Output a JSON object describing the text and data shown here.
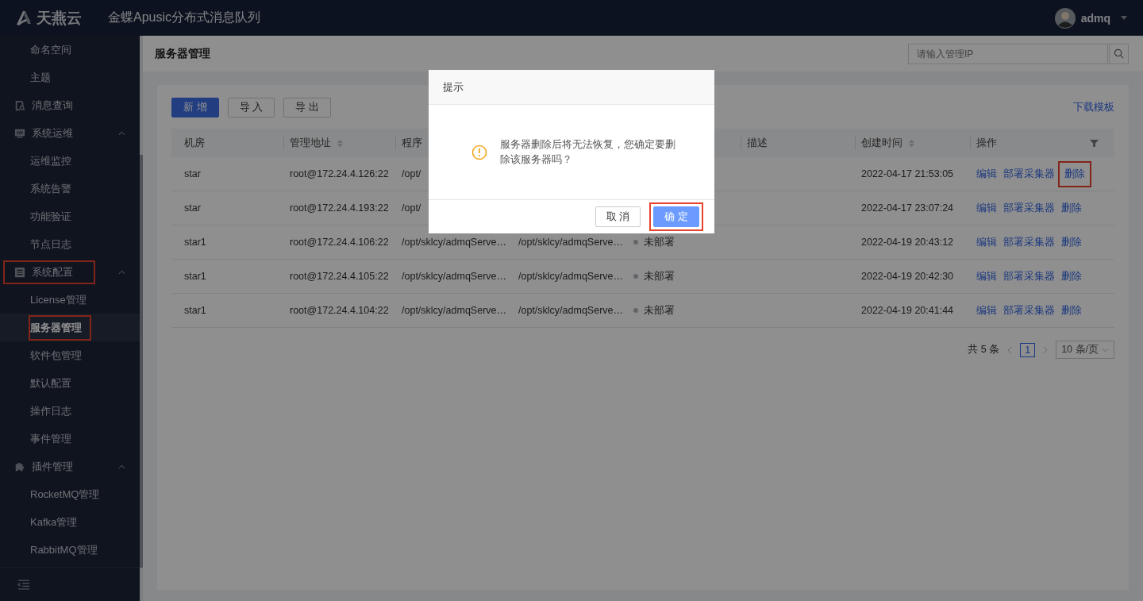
{
  "header": {
    "logo_text": "天燕云",
    "app_title": "金蝶Apusic分布式消息队列",
    "user": "admq"
  },
  "sidebar": {
    "items": [
      {
        "kind": "item",
        "label": "命名空间",
        "selected": false,
        "highlighted": false
      },
      {
        "kind": "item",
        "label": "主题",
        "selected": false,
        "highlighted": false
      },
      {
        "kind": "link",
        "label": "消息查询",
        "selected": false,
        "highlighted": false
      },
      {
        "kind": "group",
        "label": "系统运维",
        "expanded": true,
        "highlighted": false,
        "children": [
          {
            "label": "运维监控",
            "selected": false,
            "highlighted": false
          },
          {
            "label": "系统告警",
            "selected": false,
            "highlighted": false
          },
          {
            "label": "功能验证",
            "selected": false,
            "highlighted": false
          },
          {
            "label": "节点日志",
            "selected": false,
            "highlighted": false
          }
        ]
      },
      {
        "kind": "group",
        "label": "系统配置",
        "expanded": true,
        "highlighted": true,
        "children": [
          {
            "label": "License管理",
            "selected": false,
            "highlighted": false
          },
          {
            "label": "服务器管理",
            "selected": true,
            "highlighted": true
          },
          {
            "label": "软件包管理",
            "selected": false,
            "highlighted": false
          },
          {
            "label": "默认配置",
            "selected": false,
            "highlighted": false
          },
          {
            "label": "操作日志",
            "selected": false,
            "highlighted": false
          },
          {
            "label": "事件管理",
            "selected": false,
            "highlighted": false
          }
        ]
      },
      {
        "kind": "group",
        "label": "插件管理",
        "expanded": true,
        "highlighted": false,
        "children": [
          {
            "label": "RocketMQ管理",
            "selected": false,
            "highlighted": false
          },
          {
            "label": "Kafka管理",
            "selected": false,
            "highlighted": false
          },
          {
            "label": "RabbitMQ管理",
            "selected": false,
            "highlighted": false
          }
        ]
      }
    ]
  },
  "page": {
    "title": "服务器管理",
    "search": {
      "placeholder": "请输入管理IP"
    }
  },
  "toolbar": {
    "buttons": [
      {
        "label": "新 增",
        "kind": "primary"
      },
      {
        "label": "导 入",
        "kind": "default"
      },
      {
        "label": "导 出",
        "kind": "default"
      }
    ],
    "link": "下载模板"
  },
  "table": {
    "columns": [
      {
        "label": "机房",
        "sortable": false
      },
      {
        "label": "管理地址",
        "sortable": true
      },
      {
        "label": "程序"
      },
      {},
      {},
      {
        "label": "描述",
        "sortable": false
      },
      {
        "label": "创建时间",
        "sortable": true
      },
      {
        "label": "操作",
        "sortable": false,
        "filter": true
      }
    ],
    "rows": [
      {
        "cells": [
          "star",
          "root@172.24.4.126:22",
          "/opt/",
          null,
          null,
          null,
          "2022-04-17 21:53:05"
        ],
        "actions": [
          {
            "label": "编辑",
            "highlighted": false
          },
          {
            "label": "部署采集器",
            "highlighted": false
          },
          {
            "label": "删除",
            "highlighted": true
          }
        ]
      },
      {
        "cells": [
          "star",
          "root@172.24.4.193:22",
          "/opt/",
          null,
          null,
          null,
          "2022-04-17 23:07:24"
        ],
        "actions": [
          {
            "label": "编辑",
            "highlighted": false
          },
          {
            "label": "部署采集器",
            "highlighted": false
          },
          {
            "label": "删除",
            "highlighted": false
          }
        ]
      },
      {
        "cells": [
          "star1",
          "root@172.24.4.106:22",
          "/opt/sklcy/admqServe…",
          "/opt/sklcy/admqServe…",
          "未部署",
          null,
          "2022-04-19 20:43:12"
        ],
        "actions": [
          {
            "label": "编辑",
            "highlighted": false
          },
          {
            "label": "部署采集器",
            "highlighted": false
          },
          {
            "label": "删除",
            "highlighted": false
          }
        ]
      },
      {
        "cells": [
          "star1",
          "root@172.24.4.105:22",
          "/opt/sklcy/admqServe…",
          "/opt/sklcy/admqServe…",
          "未部署",
          null,
          "2022-04-19 20:42:30"
        ],
        "actions": [
          {
            "label": "编辑",
            "highlighted": false
          },
          {
            "label": "部署采集器",
            "highlighted": false
          },
          {
            "label": "删除",
            "highlighted": false
          }
        ]
      },
      {
        "cells": [
          "star1",
          "root@172.24.4.104:22",
          "/opt/sklcy/admqServe…",
          "/opt/sklcy/admqServe…",
          "未部署",
          null,
          "2022-04-19 20:41:44"
        ],
        "actions": [
          {
            "label": "编辑",
            "highlighted": false
          },
          {
            "label": "部署采集器",
            "highlighted": false
          },
          {
            "label": "删除",
            "highlighted": false
          }
        ]
      }
    ]
  },
  "pagination": {
    "total": "共 5 条",
    "pages": [
      {
        "label": "1",
        "selected": true
      }
    ],
    "page_size": "10 条/页"
  },
  "dialog": {
    "title": "提示",
    "message": "服务器删除后将无法恢复，您确定要删除该服务器吗？",
    "buttons": [
      {
        "label": "取 消",
        "kind": "default",
        "highlighted": false
      },
      {
        "label": "确 定",
        "kind": "primary",
        "highlighted": true
      }
    ]
  }
}
